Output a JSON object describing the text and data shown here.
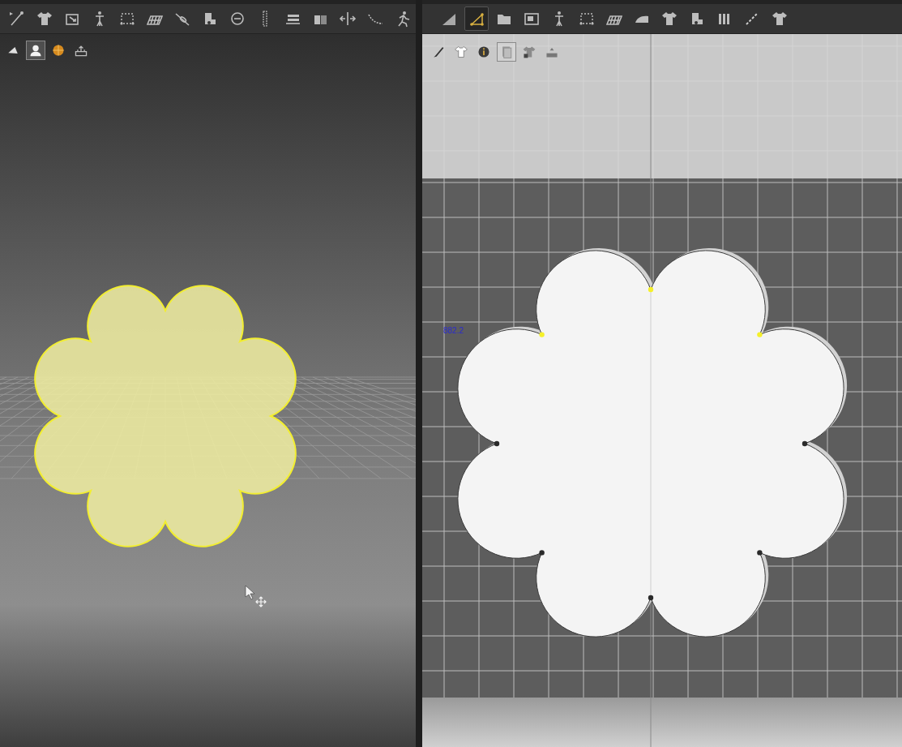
{
  "left_toolbar": [
    {
      "selected": false
    },
    {
      "selected": false
    },
    {
      "selected": false
    },
    {
      "selected": false
    },
    {
      "selected": false
    },
    {
      "selected": false
    },
    {
      "selected": false
    },
    {
      "selected": false
    },
    {
      "selected": false
    },
    {
      "selected": false
    },
    {
      "selected": false
    },
    {
      "selected": false
    },
    {
      "selected": false
    },
    {
      "selected": false
    },
    {
      "selected": false
    }
  ],
  "left_view_tools": [
    {
      "selected": false
    },
    {
      "selected": true
    },
    {
      "selected": false
    },
    {
      "selected": false
    }
  ],
  "right_toolbar": [
    {
      "selected": false
    },
    {
      "selected": true
    },
    {
      "selected": false
    },
    {
      "selected": false
    },
    {
      "selected": false
    },
    {
      "selected": false
    },
    {
      "selected": false
    },
    {
      "selected": false
    },
    {
      "selected": false
    },
    {
      "selected": false
    },
    {
      "selected": false
    },
    {
      "selected": false
    },
    {
      "selected": false
    }
  ],
  "right_view_tools": [
    {
      "selected": false
    },
    {
      "selected": false
    },
    {
      "selected": false
    },
    {
      "selected": true
    },
    {
      "selected": false
    },
    {
      "selected": false
    }
  ],
  "pattern": {
    "measurement": "882.2",
    "points": [
      {
        "selected": true
      },
      {
        "selected": true
      },
      {
        "selected": false
      },
      {
        "selected": false
      },
      {
        "selected": false
      },
      {
        "selected": false
      },
      {
        "selected": false
      },
      {
        "selected": true
      }
    ]
  }
}
